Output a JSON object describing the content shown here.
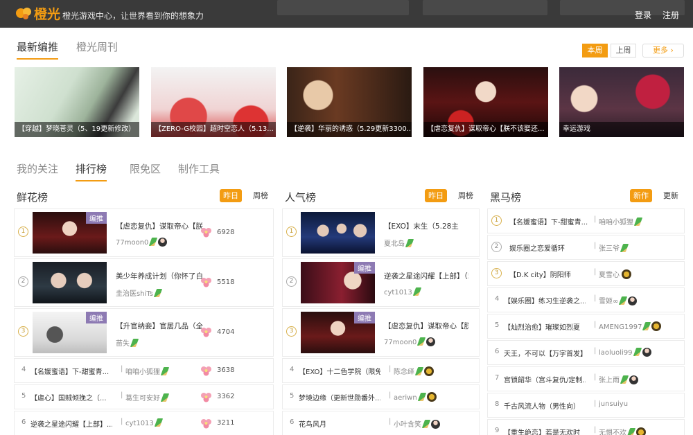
{
  "header": {
    "brand": "橙光",
    "slogan": "橙光游戏中心，让世界看到你的想象力",
    "login": "登录",
    "register": "注册",
    "accent": "#f39c12"
  },
  "featured": {
    "tabs": [
      "最新编推",
      "橙光周刊"
    ],
    "week_buttons": [
      "本周",
      "上周"
    ],
    "more": "更多",
    "banners": [
      {
        "caption": "【穿越】梦晓苍灵（5、19更新修改）"
      },
      {
        "caption": "【ZERO-G校园】超时空恋人（5.13..."
      },
      {
        "caption": "【逆袭】华丽的诱惑（5.29更新3300..."
      },
      {
        "caption": "【虐恋复仇】谋取帝心【朕不该娶还..."
      },
      {
        "caption": "幸运游戏"
      }
    ]
  },
  "ranking": {
    "tabs": [
      "我的关注",
      "排行榜",
      "限免区",
      "制作工具"
    ],
    "columns": [
      {
        "title": "鲜花榜",
        "toggles": [
          "昨日",
          "周榜"
        ],
        "entries": [
          {
            "rank": "1",
            "title": "【虐恋复仇】谋取帝心【朕不",
            "author": "77moon0",
            "tag": "编推",
            "count": "6928"
          },
          {
            "rank": "2",
            "title": "美少年养成计划（你怀了白白",
            "author": "圭治医shiTs",
            "count": "5518"
          },
          {
            "rank": "3",
            "title": "【升官纳妾】官居几品（全正",
            "author": "苗失",
            "tag": "编推",
            "count": "4704"
          },
          {
            "rank": "4",
            "title": "【名媛蜜语】下-甜蜜青...",
            "author": "咱咱小狐狸",
            "count": "3638"
          },
          {
            "rank": "5",
            "title": "【虐心】国贼倾挽之（...",
            "author": "葛生可安好",
            "count": "3362"
          },
          {
            "rank": "6",
            "title": "逆袭之星途闪耀【上部】...",
            "author": "cyt1013",
            "count": "3211"
          }
        ]
      },
      {
        "title": "人气榜",
        "toggles": [
          "昨日",
          "周榜"
        ],
        "entries": [
          {
            "rank": "1",
            "title": "【EXO】末生（5.28主",
            "author": "夏北岛"
          },
          {
            "rank": "2",
            "title": "逆袭之星途闪耀【上部】（5",
            "author": "cyt1013",
            "tag": "编推"
          },
          {
            "rank": "3",
            "title": "【虐恋复仇】谋取帝心【朕不",
            "author": "77moon0",
            "tag": "编推"
          },
          {
            "rank": "4",
            "title": "【EXO】十二色学院（限免",
            "author": "陈念绎"
          },
          {
            "rank": "5",
            "title": "梦境边缘（更新世勋番外...",
            "author": "aeriwn"
          },
          {
            "rank": "6",
            "title": "花鸟风月",
            "author": "小叶含笑"
          }
        ]
      },
      {
        "title": "黑马榜",
        "toggles": [
          "新作",
          "更新"
        ],
        "entries": [
          {
            "rank": "1",
            "title": "【名媛蜜语】下-甜蜜青...",
            "author": "咱咱小狐狸"
          },
          {
            "rank": "2",
            "title": "娱乐圈之恋爱循环",
            "author": "张三爷"
          },
          {
            "rank": "3",
            "title": "【D.K city】阴阳师",
            "author": "夏雪心"
          },
          {
            "rank": "4",
            "title": "【娱乐圈】练习生逆袭之...",
            "author": "雪姬∞"
          },
          {
            "rank": "5",
            "title": "【灿烈治愈】璀璨如烈夏",
            "author": "AMENG1997"
          },
          {
            "rank": "6",
            "title": "天王，不可以【万字首发】",
            "author": "laoluoli99"
          },
          {
            "rank": "7",
            "title": "宫锁韶华（宫斗复仇/定制...",
            "author": "张上雨"
          },
          {
            "rank": "8",
            "title": "千古风流人物（男性向）",
            "author": "junsuiyu"
          },
          {
            "rank": "9",
            "title": "【重生绝恋】若是无欢时",
            "author": "无惧不欢"
          }
        ]
      }
    ]
  }
}
